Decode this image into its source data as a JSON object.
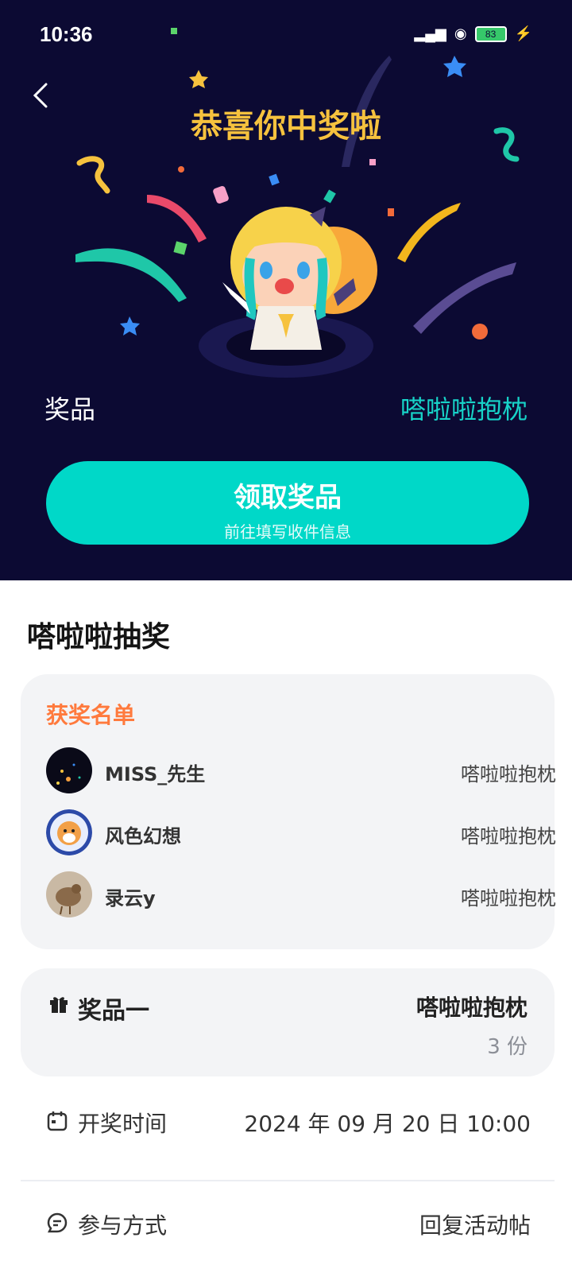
{
  "status_bar": {
    "time": "10:36",
    "battery": "83"
  },
  "hero": {
    "headline": "恭喜你中奖啦",
    "prize_label": "奖品",
    "prize_value": "嗒啦啦抱枕",
    "claim_button": {
      "title": "领取奖品",
      "subtitle": "前往填写收件信息"
    },
    "colors": {
      "background": "#0c0a33",
      "accent": "#00d8c8",
      "headline": "#f6c23e"
    }
  },
  "main": {
    "title": "嗒啦啦抽奖",
    "winners": {
      "title": "获奖名单",
      "items": [
        {
          "name": "MISS_先生",
          "prize": "嗒啦啦抱枕"
        },
        {
          "name": "风色幻想",
          "prize": "嗒啦啦抱枕"
        },
        {
          "name": "录云y",
          "prize": "嗒啦啦抱枕"
        }
      ]
    },
    "prize_card": {
      "label": "奖品一",
      "value": "嗒啦啦抱枕",
      "count": "3 份"
    },
    "draw_time": {
      "label": "开奖时间",
      "value": "2024 年 09 月 20 日 10:00"
    },
    "participation": {
      "label": "参与方式",
      "value": "回复活动帖"
    }
  }
}
